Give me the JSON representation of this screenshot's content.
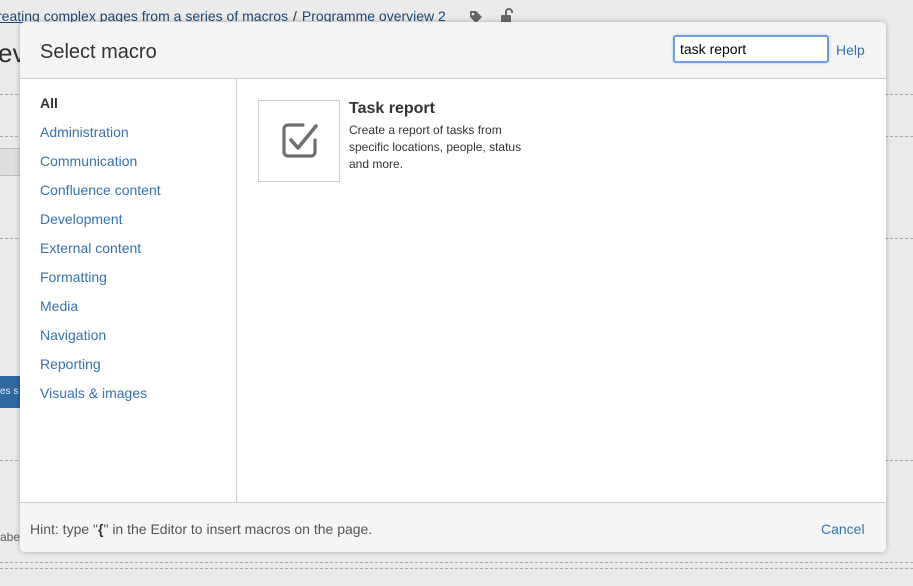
{
  "background": {
    "breadcrumb": {
      "item1": "reating complex pages from a series of macros",
      "separator": "/",
      "item2": "Programme overview 2"
    },
    "title_fragment": "ev",
    "blue_tab_text": "es s",
    "field_label_fragment": "abe"
  },
  "dialog": {
    "title": "Select macro",
    "search": {
      "value": "task report"
    },
    "help_label": "Help",
    "categories": [
      {
        "label": "All",
        "selected": true
      },
      {
        "label": "Administration"
      },
      {
        "label": "Communication"
      },
      {
        "label": "Confluence content"
      },
      {
        "label": "Development"
      },
      {
        "label": "External content"
      },
      {
        "label": "Formatting"
      },
      {
        "label": "Media"
      },
      {
        "label": "Navigation"
      },
      {
        "label": "Reporting"
      },
      {
        "label": "Visuals & images"
      }
    ],
    "results": [
      {
        "name": "Task report",
        "description": "Create a report of tasks from specific locations, people, status and more.",
        "icon": "checkbox-checked-icon"
      }
    ],
    "footer": {
      "hint_prefix": "Hint: type \"",
      "hint_key": "{",
      "hint_suffix": "\" in the Editor to insert macros on the page.",
      "cancel_label": "Cancel"
    }
  },
  "colors": {
    "link": "#3572b0",
    "text": "#333333",
    "header_bg": "#f5f5f5",
    "border": "#cccccc",
    "focus": "#6f9ee3"
  }
}
